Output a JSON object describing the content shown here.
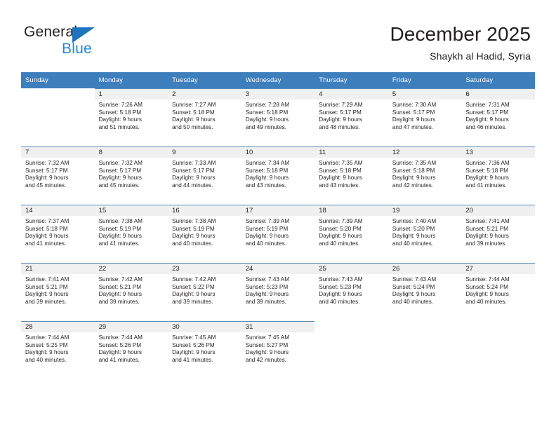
{
  "brand": {
    "name_top": "General",
    "name_bottom": "Blue",
    "triangle_color": "#1e73be",
    "blue_color": "#1e87d6"
  },
  "header": {
    "title": "December 2025",
    "subtitle": "Shaykh al Hadid, Syria",
    "header_bg": "#3d7ebd",
    "daynum_bg": "#f0f0f0"
  },
  "weekdays": [
    "Sunday",
    "Monday",
    "Tuesday",
    "Wednesday",
    "Thursday",
    "Friday",
    "Saturday"
  ],
  "labels": {
    "sunrise_prefix": "Sunrise:",
    "sunset_prefix": "Sunset:",
    "daylight_prefix": "Daylight:"
  },
  "weeks": [
    [
      {
        "day": "",
        "empty": true
      },
      {
        "day": "1",
        "line1": "Sunrise: 7:26 AM",
        "line2": "Sunset: 5:18 PM",
        "line3": "Daylight: 9 hours",
        "line4": "and 51 minutes."
      },
      {
        "day": "2",
        "line1": "Sunrise: 7:27 AM",
        "line2": "Sunset: 5:18 PM",
        "line3": "Daylight: 9 hours",
        "line4": "and 50 minutes."
      },
      {
        "day": "3",
        "line1": "Sunrise: 7:28 AM",
        "line2": "Sunset: 5:18 PM",
        "line3": "Daylight: 9 hours",
        "line4": "and 49 minutes."
      },
      {
        "day": "4",
        "line1": "Sunrise: 7:29 AM",
        "line2": "Sunset: 5:17 PM",
        "line3": "Daylight: 9 hours",
        "line4": "and 48 minutes."
      },
      {
        "day": "5",
        "line1": "Sunrise: 7:30 AM",
        "line2": "Sunset: 5:17 PM",
        "line3": "Daylight: 9 hours",
        "line4": "and 47 minutes."
      },
      {
        "day": "6",
        "line1": "Sunrise: 7:31 AM",
        "line2": "Sunset: 5:17 PM",
        "line3": "Daylight: 9 hours",
        "line4": "and 46 minutes."
      }
    ],
    [
      {
        "day": "7",
        "line1": "Sunrise: 7:32 AM",
        "line2": "Sunset: 5:17 PM",
        "line3": "Daylight: 9 hours",
        "line4": "and 45 minutes."
      },
      {
        "day": "8",
        "line1": "Sunrise: 7:32 AM",
        "line2": "Sunset: 5:17 PM",
        "line3": "Daylight: 9 hours",
        "line4": "and 45 minutes."
      },
      {
        "day": "9",
        "line1": "Sunrise: 7:33 AM",
        "line2": "Sunset: 5:17 PM",
        "line3": "Daylight: 9 hours",
        "line4": "and 44 minutes."
      },
      {
        "day": "10",
        "line1": "Sunrise: 7:34 AM",
        "line2": "Sunset: 5:18 PM",
        "line3": "Daylight: 9 hours",
        "line4": "and 43 minutes."
      },
      {
        "day": "11",
        "line1": "Sunrise: 7:35 AM",
        "line2": "Sunset: 5:18 PM",
        "line3": "Daylight: 9 hours",
        "line4": "and 43 minutes."
      },
      {
        "day": "12",
        "line1": "Sunrise: 7:35 AM",
        "line2": "Sunset: 5:18 PM",
        "line3": "Daylight: 9 hours",
        "line4": "and 42 minutes."
      },
      {
        "day": "13",
        "line1": "Sunrise: 7:36 AM",
        "line2": "Sunset: 5:18 PM",
        "line3": "Daylight: 9 hours",
        "line4": "and 41 minutes."
      }
    ],
    [
      {
        "day": "14",
        "line1": "Sunrise: 7:37 AM",
        "line2": "Sunset: 5:18 PM",
        "line3": "Daylight: 9 hours",
        "line4": "and 41 minutes."
      },
      {
        "day": "15",
        "line1": "Sunrise: 7:38 AM",
        "line2": "Sunset: 5:19 PM",
        "line3": "Daylight: 9 hours",
        "line4": "and 41 minutes."
      },
      {
        "day": "16",
        "line1": "Sunrise: 7:38 AM",
        "line2": "Sunset: 5:19 PM",
        "line3": "Daylight: 9 hours",
        "line4": "and 40 minutes."
      },
      {
        "day": "17",
        "line1": "Sunrise: 7:39 AM",
        "line2": "Sunset: 5:19 PM",
        "line3": "Daylight: 9 hours",
        "line4": "and 40 minutes."
      },
      {
        "day": "18",
        "line1": "Sunrise: 7:39 AM",
        "line2": "Sunset: 5:20 PM",
        "line3": "Daylight: 9 hours",
        "line4": "and 40 minutes."
      },
      {
        "day": "19",
        "line1": "Sunrise: 7:40 AM",
        "line2": "Sunset: 5:20 PM",
        "line3": "Daylight: 9 hours",
        "line4": "and 40 minutes."
      },
      {
        "day": "20",
        "line1": "Sunrise: 7:41 AM",
        "line2": "Sunset: 5:21 PM",
        "line3": "Daylight: 9 hours",
        "line4": "and 39 minutes."
      }
    ],
    [
      {
        "day": "21",
        "line1": "Sunrise: 7:41 AM",
        "line2": "Sunset: 5:21 PM",
        "line3": "Daylight: 9 hours",
        "line4": "and 39 minutes."
      },
      {
        "day": "22",
        "line1": "Sunrise: 7:42 AM",
        "line2": "Sunset: 5:21 PM",
        "line3": "Daylight: 9 hours",
        "line4": "and 39 minutes."
      },
      {
        "day": "23",
        "line1": "Sunrise: 7:42 AM",
        "line2": "Sunset: 5:22 PM",
        "line3": "Daylight: 9 hours",
        "line4": "and 39 minutes."
      },
      {
        "day": "24",
        "line1": "Sunrise: 7:43 AM",
        "line2": "Sunset: 5:23 PM",
        "line3": "Daylight: 9 hours",
        "line4": "and 39 minutes."
      },
      {
        "day": "25",
        "line1": "Sunrise: 7:43 AM",
        "line2": "Sunset: 5:23 PM",
        "line3": "Daylight: 9 hours",
        "line4": "and 40 minutes."
      },
      {
        "day": "26",
        "line1": "Sunrise: 7:43 AM",
        "line2": "Sunset: 5:24 PM",
        "line3": "Daylight: 9 hours",
        "line4": "and 40 minutes."
      },
      {
        "day": "27",
        "line1": "Sunrise: 7:44 AM",
        "line2": "Sunset: 5:24 PM",
        "line3": "Daylight: 9 hours",
        "line4": "and 40 minutes."
      }
    ],
    [
      {
        "day": "28",
        "line1": "Sunrise: 7:44 AM",
        "line2": "Sunset: 5:25 PM",
        "line3": "Daylight: 9 hours",
        "line4": "and 40 minutes."
      },
      {
        "day": "29",
        "line1": "Sunrise: 7:44 AM",
        "line2": "Sunset: 5:26 PM",
        "line3": "Daylight: 9 hours",
        "line4": "and 41 minutes."
      },
      {
        "day": "30",
        "line1": "Sunrise: 7:45 AM",
        "line2": "Sunset: 5:26 PM",
        "line3": "Daylight: 9 hours",
        "line4": "and 41 minutes."
      },
      {
        "day": "31",
        "line1": "Sunrise: 7:45 AM",
        "line2": "Sunset: 5:27 PM",
        "line3": "Daylight: 9 hours",
        "line4": "and 42 minutes."
      },
      {
        "day": "",
        "empty": true
      },
      {
        "day": "",
        "empty": true
      },
      {
        "day": "",
        "empty": true
      }
    ]
  ]
}
